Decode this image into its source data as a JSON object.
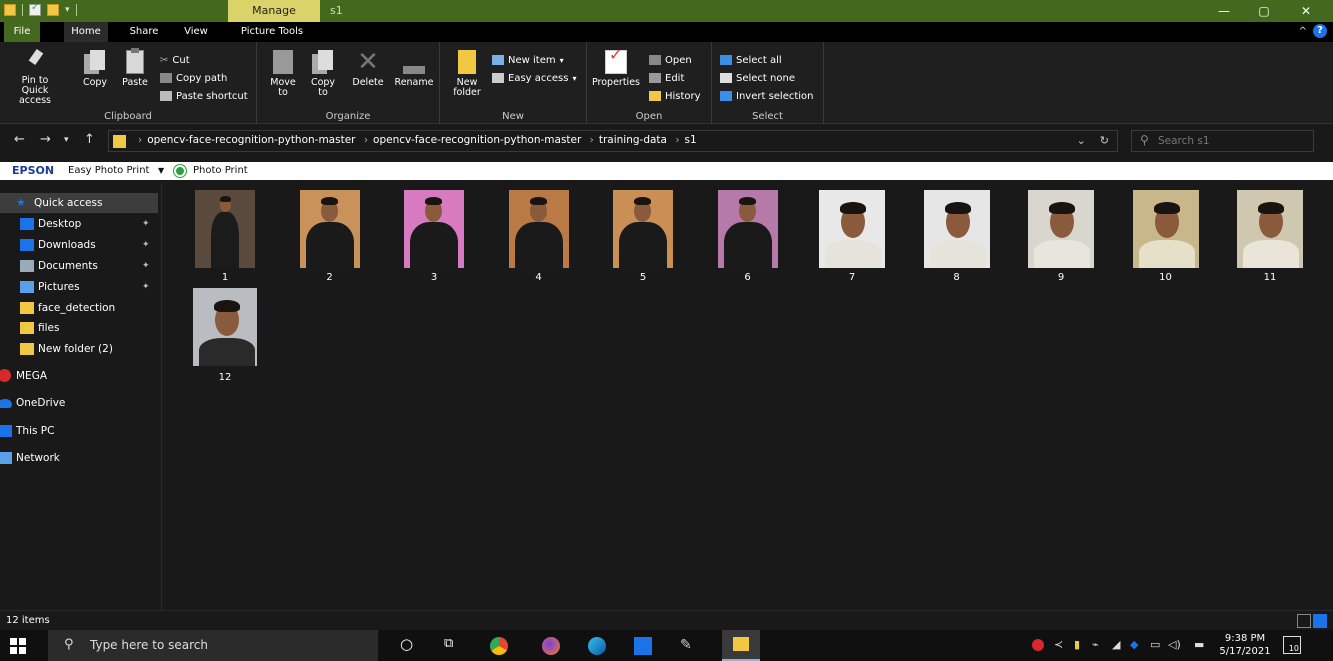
{
  "titlebar": {
    "manage_tab": "Manage",
    "title": "s1",
    "minimize": "—",
    "maximize": "▢",
    "close": "✕"
  },
  "ribbon_tabs": [
    "File",
    "Home",
    "Share",
    "View",
    "Picture Tools"
  ],
  "ribbon": {
    "clipboard": {
      "pin": "Pin to Quick access",
      "copy": "Copy",
      "paste": "Paste",
      "cut": "Cut",
      "copy_path": "Copy path",
      "paste_shortcut": "Paste shortcut",
      "label": "Clipboard"
    },
    "organize": {
      "move_to": "Move to",
      "copy_to": "Copy to",
      "delete": "Delete",
      "rename": "Rename",
      "label": "Organize"
    },
    "new": {
      "new_folder": "New folder",
      "new_item": "New item",
      "easy_access": "Easy access",
      "label": "New"
    },
    "open": {
      "properties": "Properties",
      "open": "Open",
      "edit": "Edit",
      "history": "History",
      "label": "Open"
    },
    "select": {
      "select_all": "Select all",
      "select_none": "Select none",
      "invert": "Invert selection",
      "label": "Select"
    }
  },
  "address": {
    "crumbs": [
      "opencv-face-recognition-python-master",
      "opencv-face-recognition-python-master",
      "training-data",
      "s1"
    ],
    "search_placeholder": "Search s1"
  },
  "epson": {
    "brand": "EPSON",
    "easy_photo_print": "Easy Photo Print",
    "photo_print": "Photo Print"
  },
  "sidebar": {
    "items": [
      {
        "label": "Quick access",
        "icon": "star-icon",
        "color": "#1a73e8"
      },
      {
        "label": "Desktop",
        "icon": "desktop-icon",
        "color": "#1a73e8",
        "pinned": true
      },
      {
        "label": "Downloads",
        "icon": "download-icon",
        "color": "#1a73e8",
        "pinned": true
      },
      {
        "label": "Documents",
        "icon": "documents-icon",
        "color": "#9ab",
        "pinned": true
      },
      {
        "label": "Pictures",
        "icon": "pictures-icon",
        "color": "#5aa0e8",
        "pinned": true
      },
      {
        "label": "face_detection",
        "icon": "folder-icon",
        "color": "#f2c744"
      },
      {
        "label": "files",
        "icon": "folder-icon",
        "color": "#f2c744"
      },
      {
        "label": "New folder (2)",
        "icon": "folder-icon",
        "color": "#f2c744"
      },
      {
        "label": "MEGA",
        "icon": "mega-icon",
        "color": "#d9272e"
      },
      {
        "label": "OneDrive",
        "icon": "cloud-icon",
        "color": "#1a73e8"
      },
      {
        "label": "This PC",
        "icon": "pc-icon",
        "color": "#1a73e8"
      },
      {
        "label": "Network",
        "icon": "network-icon",
        "color": "#5aa0e8"
      }
    ],
    "pin_glyph": "📌"
  },
  "files": [
    {
      "name": "1",
      "bg": "#5a4a3e",
      "body": "#1b1b1b",
      "style": "full"
    },
    {
      "name": "2",
      "bg": "#c9925a",
      "body": "#1a1a1a",
      "style": "half"
    },
    {
      "name": "3",
      "bg": "#d77ac0",
      "body": "#1a1a1a",
      "style": "half"
    },
    {
      "name": "4",
      "bg": "#b97a46",
      "body": "#1a1a1a",
      "style": "half"
    },
    {
      "name": "5",
      "bg": "#c98f55",
      "body": "#1a1a1a",
      "style": "half"
    },
    {
      "name": "6",
      "bg": "#b57aa8",
      "body": "#1a1a1a",
      "style": "half"
    },
    {
      "name": "7",
      "bg": "#e8e8e8",
      "body": "#e6e3da",
      "style": "face"
    },
    {
      "name": "8",
      "bg": "#e6e6e6",
      "body": "#e6e3da",
      "style": "face"
    },
    {
      "name": "9",
      "bg": "#d9d6ce",
      "body": "#e8e5dc",
      "style": "face"
    },
    {
      "name": "10",
      "bg": "#c7b78a",
      "body": "#e6e0c8",
      "style": "face"
    },
    {
      "name": "11",
      "bg": "#cfc7b0",
      "body": "#e9e5d8",
      "style": "face"
    },
    {
      "name": "12",
      "bg": "#b9bdc2",
      "body": "#2a2a2a",
      "style": "face"
    }
  ],
  "status": {
    "count": "12 items"
  },
  "taskbar": {
    "search_placeholder": "Type here to search",
    "time": "9:38 PM",
    "date": "5/17/2021",
    "notif_count": "10"
  }
}
